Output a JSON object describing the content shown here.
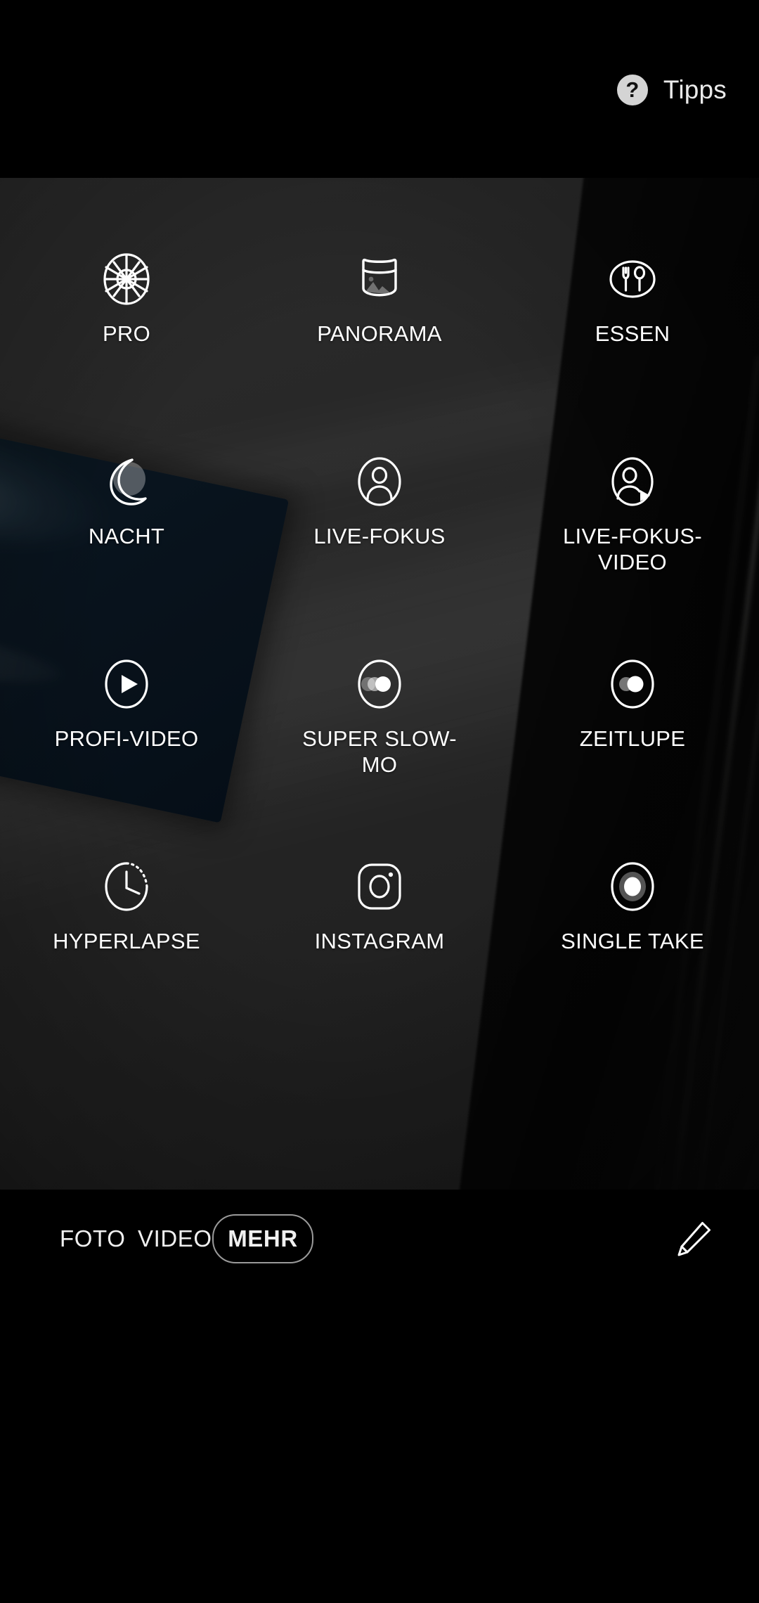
{
  "app": {
    "name": "camera-app",
    "language": "de"
  },
  "topbar": {
    "tips": {
      "label": "Tipps",
      "icon": "help-circle-icon",
      "glyph": "?"
    }
  },
  "modes": {
    "rows": 4,
    "columns": 3,
    "items": [
      {
        "label": "PRO",
        "icon": "aperture-icon"
      },
      {
        "label": "PANORAMA",
        "icon": "panorama-icon"
      },
      {
        "label": "ESSEN",
        "icon": "food-icon"
      },
      {
        "label": "NACHT",
        "icon": "moon-icon"
      },
      {
        "label": "LIVE-FOKUS",
        "icon": "portrait-person-icon"
      },
      {
        "label": "LIVE-FOKUS-\nVIDEO",
        "icon": "portrait-video-person-icon"
      },
      {
        "label": "PROFI-VIDEO",
        "icon": "play-circle-icon"
      },
      {
        "label": "SUPER SLOW-MO",
        "icon": "super-slow-motion-icon"
      },
      {
        "label": "ZEITLUPE",
        "icon": "slow-motion-icon"
      },
      {
        "label": "HYPERLAPSE",
        "icon": "clock-hyperlapse-icon"
      },
      {
        "label": "INSTAGRAM",
        "icon": "instagram-camera-icon"
      },
      {
        "label": "SINGLE TAKE",
        "icon": "single-take-icon"
      }
    ]
  },
  "bottombar": {
    "switcher": [
      {
        "label": "FOTO",
        "selected": false
      },
      {
        "label": "VIDEO",
        "selected": false
      },
      {
        "label": "MEHR",
        "selected": true
      }
    ],
    "edit": {
      "label": "",
      "icon": "pencil-edit-icon"
    }
  },
  "colors": {
    "background": "#000000",
    "text": "#ffffff",
    "selected_outline": "#9a9a9a",
    "tips_icon_fill": "#d4d4d4",
    "viewfinder_base": "#2b2b2b"
  }
}
